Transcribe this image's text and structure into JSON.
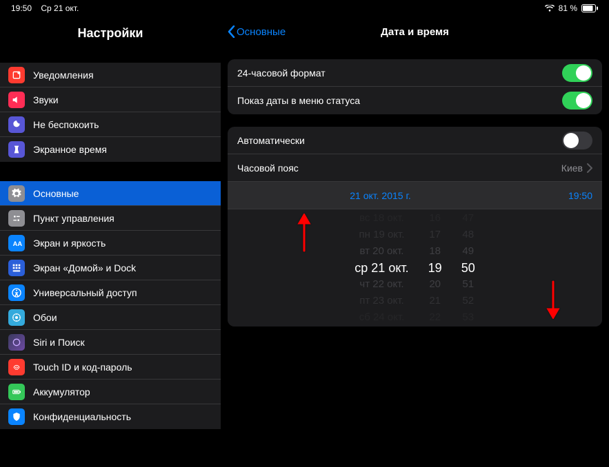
{
  "status": {
    "time": "19:50",
    "date": "Ср 21 окт.",
    "battery": "81 %"
  },
  "sidebar": {
    "title": "Настройки",
    "group1": [
      {
        "label": "Уведомления"
      },
      {
        "label": "Звуки"
      },
      {
        "label": "Не беспокоить"
      },
      {
        "label": "Экранное время"
      }
    ],
    "group2": [
      {
        "label": "Основные",
        "selected": true
      },
      {
        "label": "Пункт управления"
      },
      {
        "label": "Экран и яркость"
      },
      {
        "label": "Экран «Домой» и Dock"
      },
      {
        "label": "Универсальный доступ"
      },
      {
        "label": "Обои"
      },
      {
        "label": "Siri и Поиск"
      },
      {
        "label": "Touch ID и код-пароль"
      },
      {
        "label": "Аккумулятор"
      },
      {
        "label": "Конфиденциальность"
      }
    ]
  },
  "detail": {
    "back": "Основные",
    "title": "Дата и время",
    "rows": {
      "format24": "24-часовой формат",
      "show_date": "Показ даты в меню статуса",
      "auto": "Автоматически",
      "timezone_label": "Часовой пояс",
      "timezone_value": "Киев",
      "selected_date": "21 окт. 2015 г.",
      "selected_time": "19:50"
    },
    "toggles": {
      "format24": true,
      "show_date": true,
      "auto": false
    },
    "picker": {
      "dates": [
        "вс 18 окт.",
        "пн 19 окт.",
        "вт 20 окт.",
        "ср 21 окт.",
        "чт 22 окт.",
        "пт 23 окт.",
        "сб 24 окт."
      ],
      "hours": [
        "16",
        "17",
        "18",
        "19",
        "20",
        "21",
        "22"
      ],
      "minutes": [
        "47",
        "48",
        "49",
        "50",
        "51",
        "52",
        "53"
      ]
    }
  }
}
